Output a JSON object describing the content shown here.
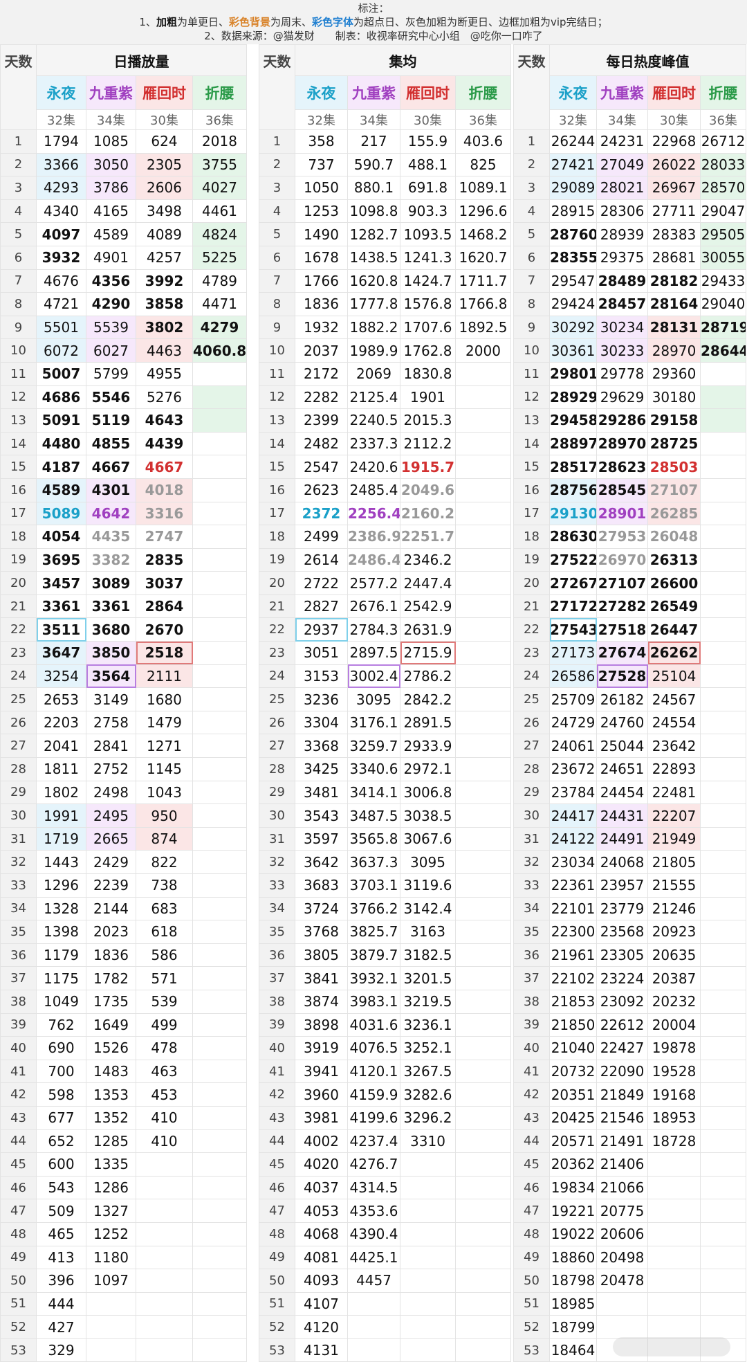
{
  "notes": {
    "title": "标注：",
    "line1": {
      "prefix": "1、",
      "bold": "加粗",
      "t1": "为单更日、",
      "bg": "彩色背景",
      "t2": "为周末、",
      "font": "彩色字体",
      "t3": "为超点日、灰色加粗为断更日、边框加粗为vip完结日；"
    },
    "line2": "2、数据来源：@猫发财　　制表：收视率研究中心小组　@吃你一口咋了"
  },
  "day_label": "天数",
  "shows": [
    {
      "name": "永夜",
      "episodes": "32集"
    },
    {
      "name": "九重紫",
      "episodes": "34集"
    },
    {
      "name": "雁回时",
      "episodes": "30集"
    },
    {
      "name": "折腰",
      "episodes": "36集"
    }
  ],
  "sections": [
    {
      "title": "日播放量",
      "rows": [
        [
          "1794",
          "1085",
          "624",
          "2018"
        ],
        [
          "3366",
          "3050",
          "2305",
          "3755"
        ],
        [
          "4293",
          "3786",
          "2606",
          "4027"
        ],
        [
          "4340",
          "4165",
          "3498",
          "4461"
        ],
        [
          "4097",
          "4589",
          "4089",
          "4824"
        ],
        [
          "3932",
          "4901",
          "4257",
          "5225"
        ],
        [
          "4676",
          "4356",
          "3992",
          "4789"
        ],
        [
          "4721",
          "4290",
          "3858",
          "4471"
        ],
        [
          "5501",
          "5539",
          "3802",
          "4279"
        ],
        [
          "6072",
          "6027",
          "4463",
          "4060.8"
        ],
        [
          "5007",
          "5799",
          "4955",
          ""
        ],
        [
          "4686",
          "5546",
          "5276",
          ""
        ],
        [
          "5091",
          "5119",
          "4643",
          ""
        ],
        [
          "4480",
          "4855",
          "4439",
          ""
        ],
        [
          "4187",
          "4667",
          "4667",
          ""
        ],
        [
          "4589",
          "4301",
          "4018",
          ""
        ],
        [
          "5089",
          "4642",
          "3316",
          ""
        ],
        [
          "4054",
          "4435",
          "2747",
          ""
        ],
        [
          "3695",
          "3382",
          "2835",
          ""
        ],
        [
          "3457",
          "3089",
          "3037",
          ""
        ],
        [
          "3361",
          "3361",
          "2864",
          ""
        ],
        [
          "3511",
          "3680",
          "2670",
          ""
        ],
        [
          "3647",
          "3850",
          "2518",
          ""
        ],
        [
          "3254",
          "3564",
          "2111",
          ""
        ],
        [
          "2653",
          "3149",
          "1680",
          ""
        ],
        [
          "2203",
          "2758",
          "1479",
          ""
        ],
        [
          "2041",
          "2841",
          "1271",
          ""
        ],
        [
          "1811",
          "2752",
          "1145",
          ""
        ],
        [
          "1802",
          "2498",
          "1043",
          ""
        ],
        [
          "1991",
          "2495",
          "950",
          ""
        ],
        [
          "1719",
          "2665",
          "874",
          ""
        ],
        [
          "1443",
          "2429",
          "822",
          ""
        ],
        [
          "1296",
          "2239",
          "738",
          ""
        ],
        [
          "1328",
          "2144",
          "683",
          ""
        ],
        [
          "1398",
          "2023",
          "618",
          ""
        ],
        [
          "1179",
          "1836",
          "586",
          ""
        ],
        [
          "1175",
          "1782",
          "571",
          ""
        ],
        [
          "1049",
          "1735",
          "539",
          ""
        ],
        [
          "762",
          "1649",
          "499",
          ""
        ],
        [
          "690",
          "1526",
          "478",
          ""
        ],
        [
          "700",
          "1483",
          "463",
          ""
        ],
        [
          "598",
          "1353",
          "453",
          ""
        ],
        [
          "677",
          "1352",
          "410",
          ""
        ],
        [
          "652",
          "1285",
          "410",
          ""
        ],
        [
          "600",
          "1335",
          "",
          ""
        ],
        [
          "543",
          "1286",
          "",
          ""
        ],
        [
          "509",
          "1327",
          "",
          ""
        ],
        [
          "465",
          "1252",
          "",
          ""
        ],
        [
          "413",
          "1180",
          "",
          ""
        ],
        [
          "396",
          "1097",
          "",
          ""
        ],
        [
          "444",
          "",
          "",
          ""
        ],
        [
          "427",
          "",
          "",
          ""
        ],
        [
          "329",
          "",
          "",
          ""
        ]
      ]
    },
    {
      "title": "集均",
      "rows": [
        [
          "358",
          "217",
          "155.9",
          "403.6"
        ],
        [
          "737",
          "590.7",
          "488.1",
          "825"
        ],
        [
          "1050",
          "880.1",
          "691.8",
          "1089.1"
        ],
        [
          "1253",
          "1098.8",
          "903.3",
          "1296.6"
        ],
        [
          "1490",
          "1282.7",
          "1093.5",
          "1468.2"
        ],
        [
          "1678",
          "1438.5",
          "1241.3",
          "1620.7"
        ],
        [
          "1766",
          "1620.8",
          "1424.7",
          "1711.7"
        ],
        [
          "1836",
          "1777.8",
          "1576.8",
          "1766.8"
        ],
        [
          "1932",
          "1882.2",
          "1707.6",
          "1892.5"
        ],
        [
          "2037",
          "1989.9",
          "1762.8",
          "2000"
        ],
        [
          "2172",
          "2069",
          "1830.8",
          ""
        ],
        [
          "2282",
          "2125.4",
          "1901",
          ""
        ],
        [
          "2399",
          "2240.5",
          "2015.3",
          ""
        ],
        [
          "2482",
          "2337.3",
          "2112.2",
          ""
        ],
        [
          "2547",
          "2420.6",
          "1915.7",
          ""
        ],
        [
          "2623",
          "2485.4",
          "2049.6",
          ""
        ],
        [
          "2372",
          "2256.4",
          "2160.2",
          ""
        ],
        [
          "2499",
          "2386.9",
          "2251.7",
          ""
        ],
        [
          "2614",
          "2486.4",
          "2346.2",
          ""
        ],
        [
          "2722",
          "2577.2",
          "2447.4",
          ""
        ],
        [
          "2827",
          "2676.1",
          "2542.9",
          ""
        ],
        [
          "2937",
          "2784.3",
          "2631.9",
          ""
        ],
        [
          "3051",
          "2897.5",
          "2715.9",
          ""
        ],
        [
          "3153",
          "3002.4",
          "2786.2",
          ""
        ],
        [
          "3236",
          "3095",
          "2842.2",
          ""
        ],
        [
          "3304",
          "3176.1",
          "2891.5",
          ""
        ],
        [
          "3368",
          "3259.7",
          "2933.9",
          ""
        ],
        [
          "3425",
          "3340.6",
          "2972.1",
          ""
        ],
        [
          "3481",
          "3414.1",
          "3006.8",
          ""
        ],
        [
          "3543",
          "3487.5",
          "3038.5",
          ""
        ],
        [
          "3597",
          "3565.8",
          "3067.6",
          ""
        ],
        [
          "3642",
          "3637.3",
          "3095",
          ""
        ],
        [
          "3683",
          "3703.1",
          "3119.6",
          ""
        ],
        [
          "3724",
          "3766.2",
          "3142.4",
          ""
        ],
        [
          "3768",
          "3825.7",
          "3163",
          ""
        ],
        [
          "3805",
          "3879.7",
          "3182.5",
          ""
        ],
        [
          "3841",
          "3932.1",
          "3201.5",
          ""
        ],
        [
          "3874",
          "3983.1",
          "3219.5",
          ""
        ],
        [
          "3898",
          "4031.6",
          "3236.1",
          ""
        ],
        [
          "3919",
          "4076.5",
          "3252.1",
          ""
        ],
        [
          "3941",
          "4120.1",
          "3267.5",
          ""
        ],
        [
          "3960",
          "4159.9",
          "3282.6",
          ""
        ],
        [
          "3981",
          "4199.6",
          "3296.2",
          ""
        ],
        [
          "4002",
          "4237.4",
          "3310",
          ""
        ],
        [
          "4020",
          "4276.7",
          "",
          ""
        ],
        [
          "4037",
          "4314.5",
          "",
          ""
        ],
        [
          "4053",
          "4353.6",
          "",
          ""
        ],
        [
          "4068",
          "4390.4",
          "",
          ""
        ],
        [
          "4081",
          "4425.1",
          "",
          ""
        ],
        [
          "4093",
          "4457",
          "",
          ""
        ],
        [
          "4107",
          "",
          "",
          ""
        ],
        [
          "4120",
          "",
          "",
          ""
        ],
        [
          "4131",
          "",
          "",
          ""
        ]
      ]
    },
    {
      "title": "每日热度峰值",
      "rows": [
        [
          "26244",
          "24231",
          "22968",
          "26712"
        ],
        [
          "27421",
          "27049",
          "26022",
          "28033"
        ],
        [
          "29089",
          "28021",
          "26967",
          "28570"
        ],
        [
          "28915",
          "28306",
          "27711",
          "29047"
        ],
        [
          "28760",
          "28939",
          "28383",
          "29505"
        ],
        [
          "28355",
          "29375",
          "28681",
          "30055"
        ],
        [
          "29547",
          "28489",
          "28182",
          "29433"
        ],
        [
          "29424",
          "28457",
          "28164",
          "29040"
        ],
        [
          "30292",
          "30234",
          "28131",
          "28719"
        ],
        [
          "30361",
          "30233",
          "28970",
          "28644"
        ],
        [
          "29801",
          "29778",
          "29360",
          ""
        ],
        [
          "28929",
          "29629",
          "30180",
          ""
        ],
        [
          "29458",
          "29286",
          "29158",
          ""
        ],
        [
          "28897",
          "28970",
          "28725",
          ""
        ],
        [
          "28517",
          "28623",
          "28503",
          ""
        ],
        [
          "28756",
          "28545",
          "27107",
          ""
        ],
        [
          "29130",
          "28901",
          "26285",
          ""
        ],
        [
          "28630",
          "27953",
          "26048",
          ""
        ],
        [
          "27522",
          "26970",
          "26313",
          ""
        ],
        [
          "27267",
          "27107",
          "26600",
          ""
        ],
        [
          "27172",
          "27282",
          "26549",
          ""
        ],
        [
          "27543",
          "27518",
          "26447",
          ""
        ],
        [
          "27173",
          "27674",
          "26262",
          ""
        ],
        [
          "26586",
          "27528",
          "25104",
          ""
        ],
        [
          "25709",
          "26182",
          "24567",
          ""
        ],
        [
          "24729",
          "24760",
          "24554",
          ""
        ],
        [
          "24061",
          "25044",
          "23642",
          ""
        ],
        [
          "23672",
          "24651",
          "22893",
          ""
        ],
        [
          "23784",
          "24454",
          "22481",
          ""
        ],
        [
          "24417",
          "24431",
          "22207",
          ""
        ],
        [
          "24122",
          "24491",
          "21949",
          ""
        ],
        [
          "23034",
          "24068",
          "21805",
          ""
        ],
        [
          "22361",
          "23957",
          "21555",
          ""
        ],
        [
          "22101",
          "23779",
          "21246",
          ""
        ],
        [
          "22300",
          "23568",
          "20923",
          ""
        ],
        [
          "21961",
          "23305",
          "20635",
          ""
        ],
        [
          "22102",
          "23224",
          "20387",
          ""
        ],
        [
          "21853",
          "23092",
          "20232",
          ""
        ],
        [
          "21850",
          "22612",
          "20004",
          ""
        ],
        [
          "21040",
          "22427",
          "19878",
          ""
        ],
        [
          "20732",
          "22090",
          "19528",
          ""
        ],
        [
          "20351",
          "21849",
          "19168",
          ""
        ],
        [
          "20425",
          "21546",
          "18953",
          ""
        ],
        [
          "20571",
          "21491",
          "18728",
          ""
        ],
        [
          "20362",
          "21406",
          "",
          ""
        ],
        [
          "19834",
          "21066",
          "",
          ""
        ],
        [
          "19221",
          "20775",
          "",
          ""
        ],
        [
          "19022",
          "20606",
          "",
          ""
        ],
        [
          "18860",
          "20498",
          "",
          ""
        ],
        [
          "18798",
          "20478",
          "",
          ""
        ],
        [
          "18985",
          "",
          "",
          ""
        ],
        [
          "18799",
          "",
          "",
          ""
        ],
        [
          "18464",
          "",
          "",
          ""
        ]
      ]
    }
  ]
}
